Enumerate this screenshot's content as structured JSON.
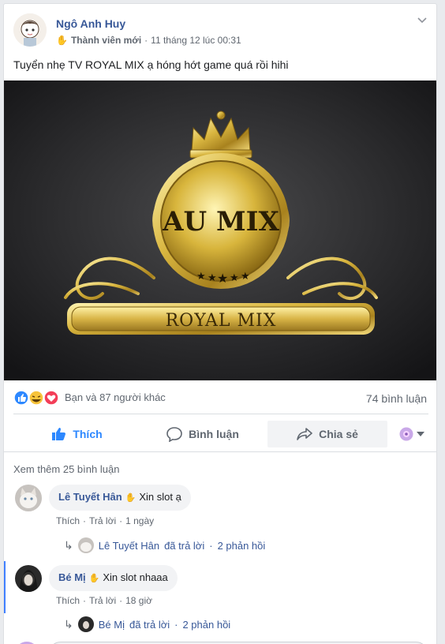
{
  "post": {
    "author": "Ngô Anh Huy",
    "badge": "Thành viên mới",
    "timestamp": "11 tháng 12 lúc 00:31",
    "body": "Tuyển nhẹ TV ROYAL MIX ạ hóng hớt game quá rồi hihi",
    "image": {
      "logo_main": "AU MIX",
      "logo_banner": "ROYAL MIX"
    }
  },
  "reactions": {
    "summary": "Bạn và 87 người khác",
    "comments_count": "74 bình luận"
  },
  "actions": {
    "like": "Thích",
    "comment": "Bình luận",
    "share": "Chia sẻ"
  },
  "comments": {
    "view_more": "Xem thêm 25 bình luận",
    "items": [
      {
        "name": "Lê Tuyết Hân",
        "text": "Xin slot ạ",
        "like": "Thích",
        "reply": "Trả lời",
        "time": "1 ngày",
        "reply_summary_name": "Lê Tuyết Hân",
        "reply_summary_text": "đã trả lời",
        "reply_count": "2 phản hồi"
      },
      {
        "name": "Bé Mị",
        "text": "Xin slot nhaaa",
        "like": "Thích",
        "reply": "Trả lời",
        "time": "18 giờ",
        "reply_summary_name": "Bé Mị",
        "reply_summary_text": "đã trả lời",
        "reply_count": "2 phản hồi"
      }
    ]
  },
  "colors": {
    "link": "#385898",
    "like_blue": "#2d88ff",
    "gold": "#d9b640"
  }
}
